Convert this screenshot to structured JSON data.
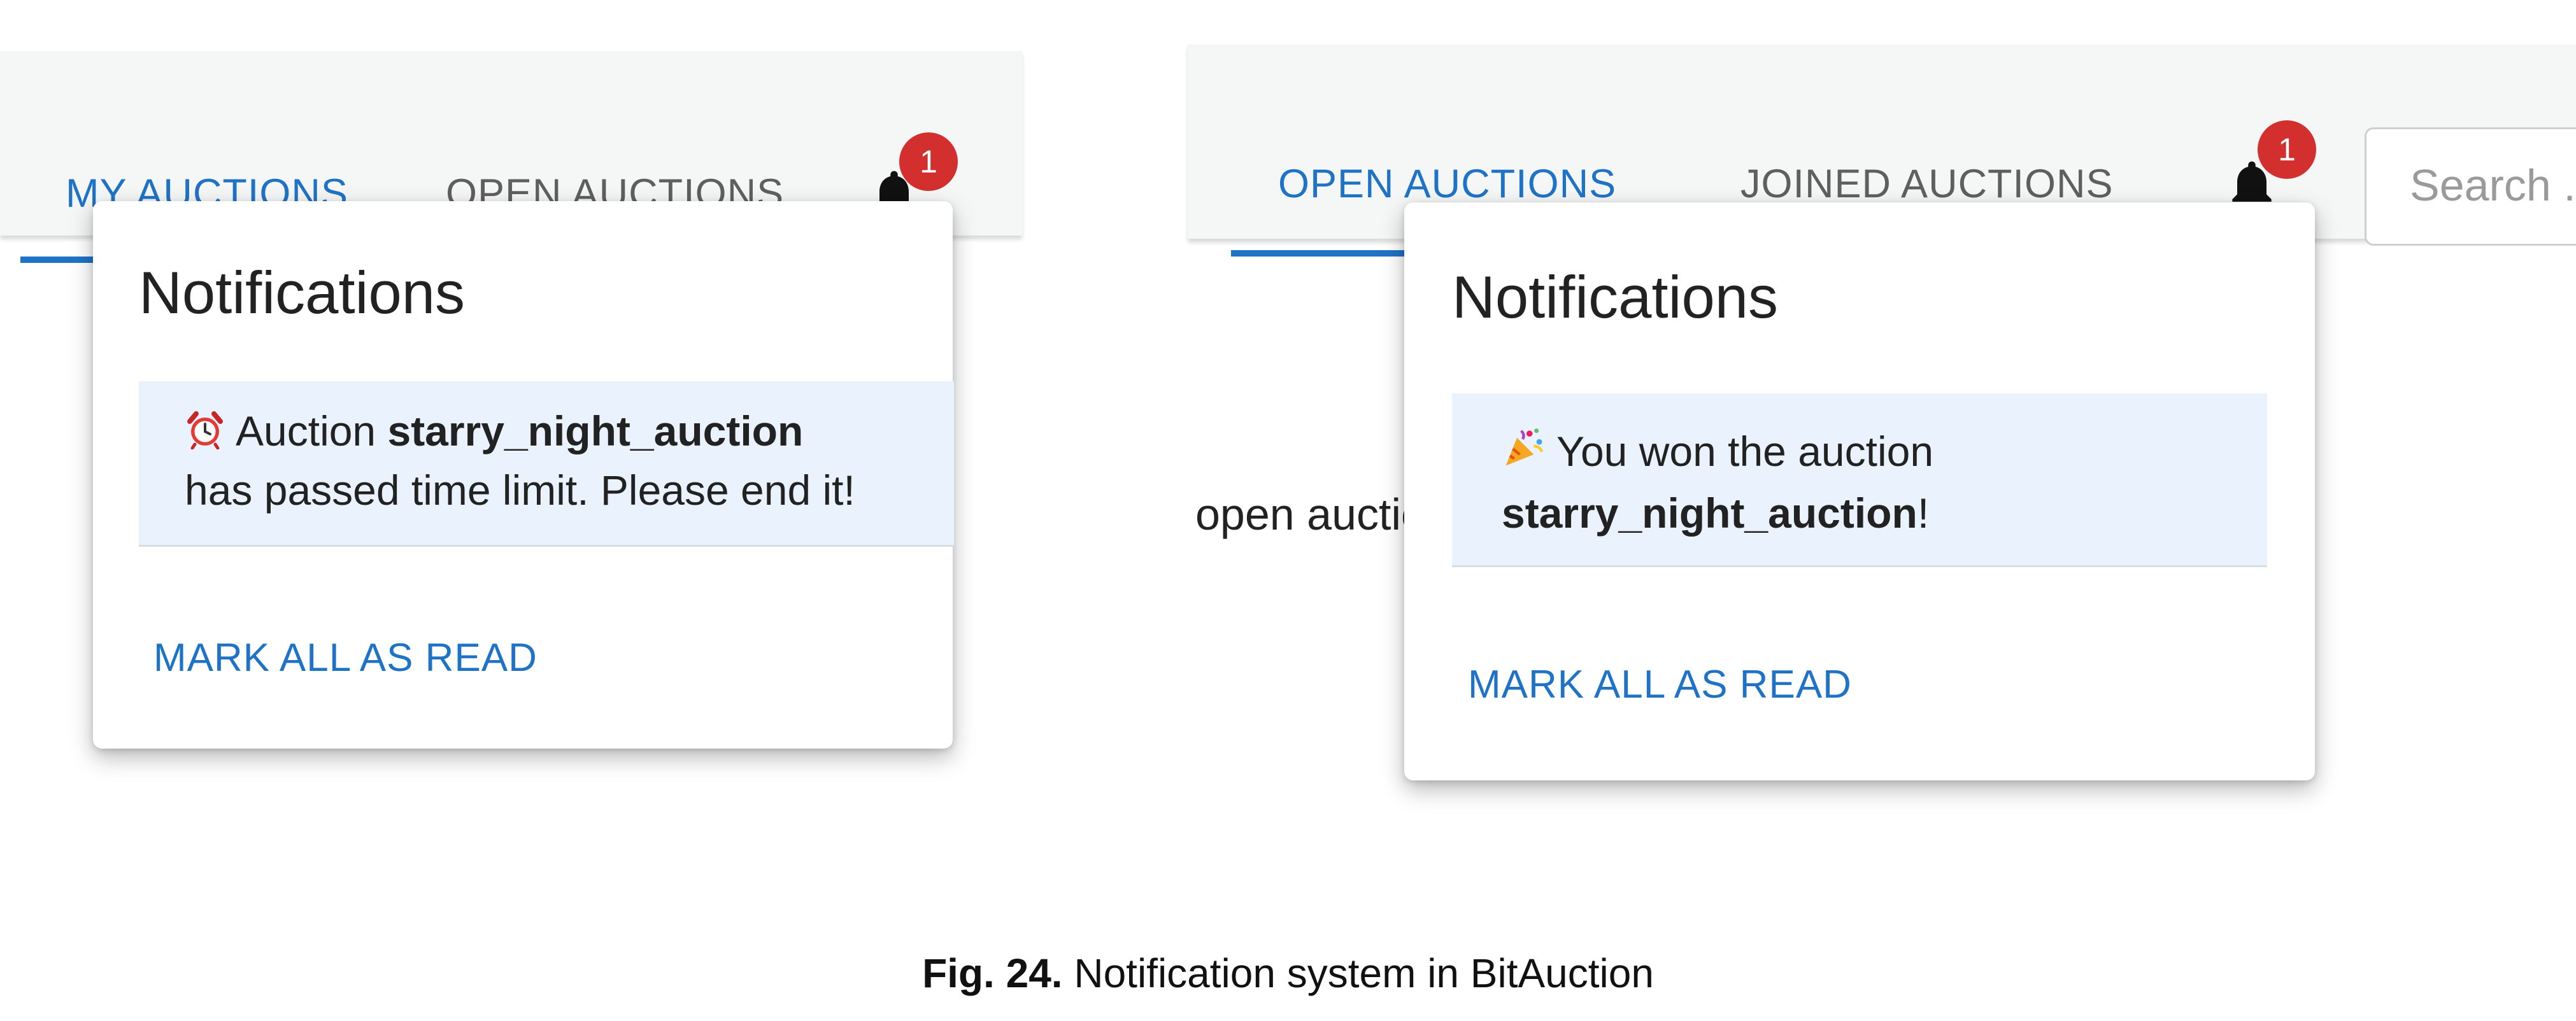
{
  "left_screen": {
    "tabs": [
      {
        "label": "MY AUCTIONS",
        "active": true
      },
      {
        "label": "OPEN AUCTIONS",
        "active": false
      }
    ],
    "notification_badge": "1",
    "popover": {
      "title": "Notifications",
      "items": [
        {
          "icon": "alarm-clock-icon",
          "prefix": "Auction ",
          "auction_name": "starry_night_auction",
          "suffix": "has passed time limit. Please end it!"
        }
      ],
      "mark_all_label": "MARK ALL AS READ"
    }
  },
  "right_screen": {
    "tabs": [
      {
        "label": "OPEN AUCTIONS",
        "active": true
      },
      {
        "label": "JOINED AUCTIONS",
        "active": false
      }
    ],
    "notification_badge": "1",
    "search_placeholder": "Search ...",
    "background_text": "open auctions",
    "popover": {
      "title": "Notifications",
      "items": [
        {
          "icon": "party-popper-icon",
          "prefix": "You won the auction",
          "auction_name": "starry_night_auction",
          "suffix": "!"
        }
      ],
      "mark_all_label": "MARK ALL AS READ"
    }
  },
  "caption": {
    "label": "Fig. 24.",
    "text": " Notification system in BitAuction"
  },
  "colors": {
    "accent": "#1f73c7",
    "badge": "#d32f2f",
    "notification_bg": "#e9f2fd",
    "appbar_bg": "#f5f6f6"
  }
}
